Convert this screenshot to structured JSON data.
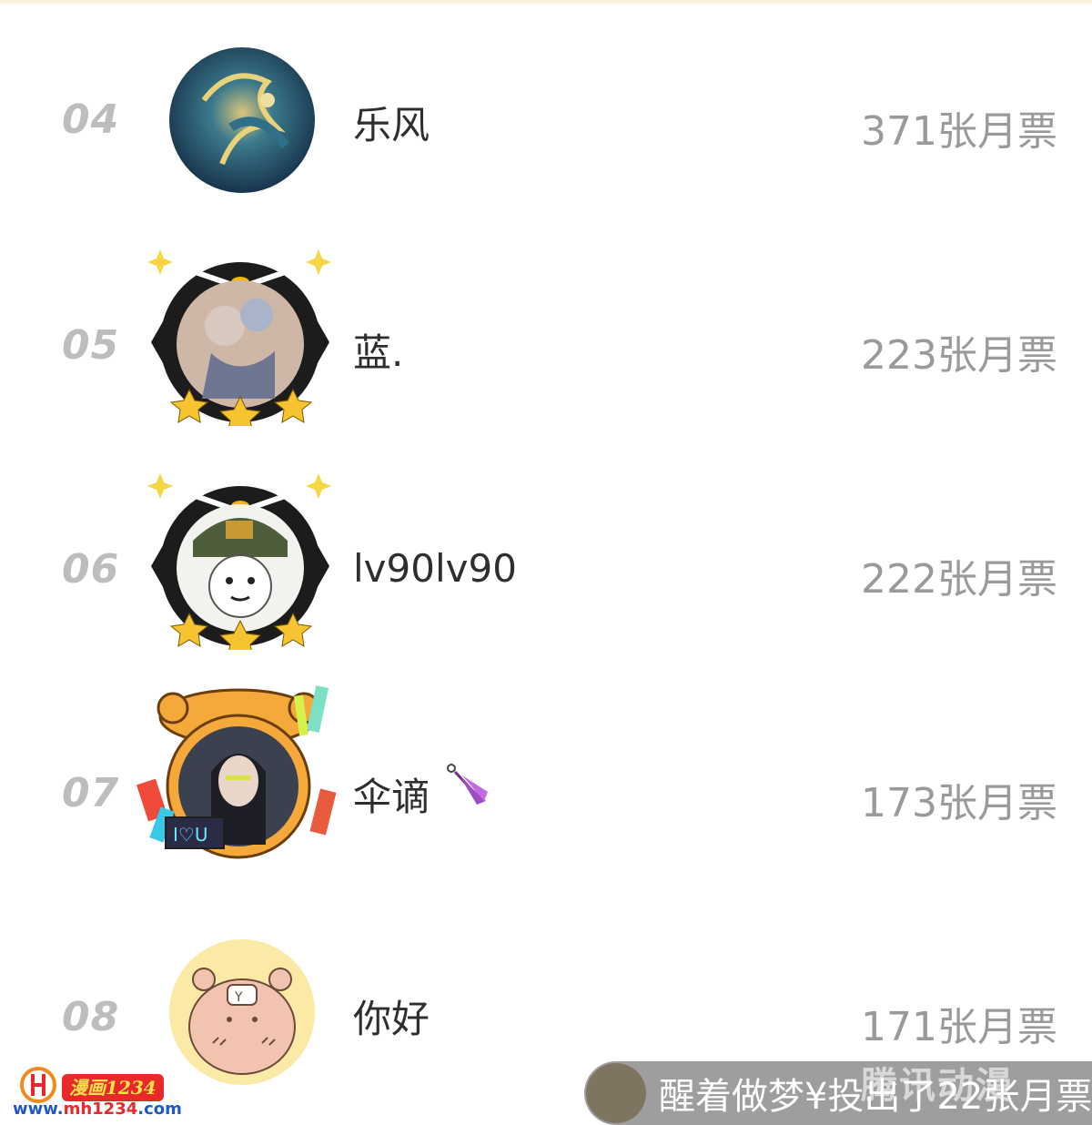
{
  "ranking": [
    {
      "rank": "04",
      "name": "乐风",
      "votes": "371张月票"
    },
    {
      "rank": "05",
      "name": "蓝.",
      "votes": "223张月票"
    },
    {
      "rank": "06",
      "name": "lv90lv90",
      "votes": "222张月票"
    },
    {
      "rank": "07",
      "name": "伞谪",
      "votes": "173张月票"
    },
    {
      "rank": "08",
      "name": "你好",
      "votes": "171张月票"
    }
  ],
  "banner": {
    "text": "醒着做梦¥投出了22张月票",
    "watermark": "腾讯动漫"
  },
  "site_watermark": {
    "badge": "漫画1234",
    "url_prefix": "www.",
    "url_domain": "mh1234",
    "url_suffix": ".com"
  },
  "colors": {
    "rank": "#bdbdbd",
    "name": "#2e2e2e",
    "votes": "#9a9a9a",
    "banner_bg": "#9e9e9e"
  }
}
